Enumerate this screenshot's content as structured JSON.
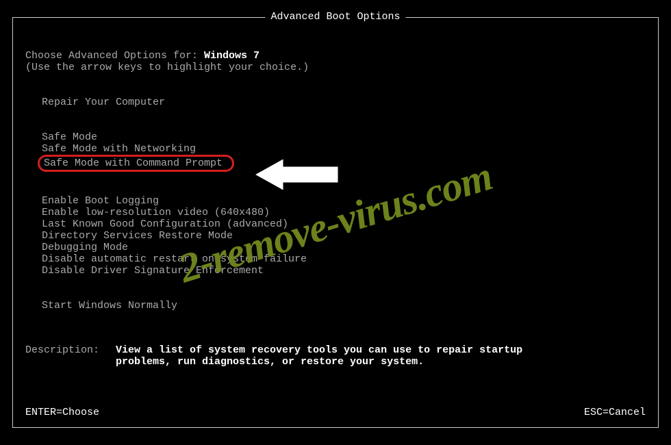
{
  "title": "Advanced Boot Options",
  "prompt_prefix": "Choose Advanced Options for: ",
  "os_name": "Windows 7",
  "hint": "(Use the arrow keys to highlight your choice.)",
  "groups": [
    {
      "items": [
        "Repair Your Computer"
      ]
    },
    {
      "items": [
        "Safe Mode",
        "Safe Mode with Networking",
        "Safe Mode with Command Prompt"
      ],
      "highlighted_index": 2
    },
    {
      "items": [
        "Enable Boot Logging",
        "Enable low-resolution video (640x480)",
        "Last Known Good Configuration (advanced)",
        "Directory Services Restore Mode",
        "Debugging Mode",
        "Disable automatic restart on system failure",
        "Disable Driver Signature Enforcement"
      ]
    },
    {
      "items": [
        "Start Windows Normally"
      ]
    }
  ],
  "description_label": "Description:",
  "description_text": "View a list of system recovery tools you can use to repair startup problems, run diagnostics, or restore your system.",
  "footer": {
    "left": "ENTER=Choose",
    "right": "ESC=Cancel"
  },
  "watermark": "2-remove-virus.com"
}
